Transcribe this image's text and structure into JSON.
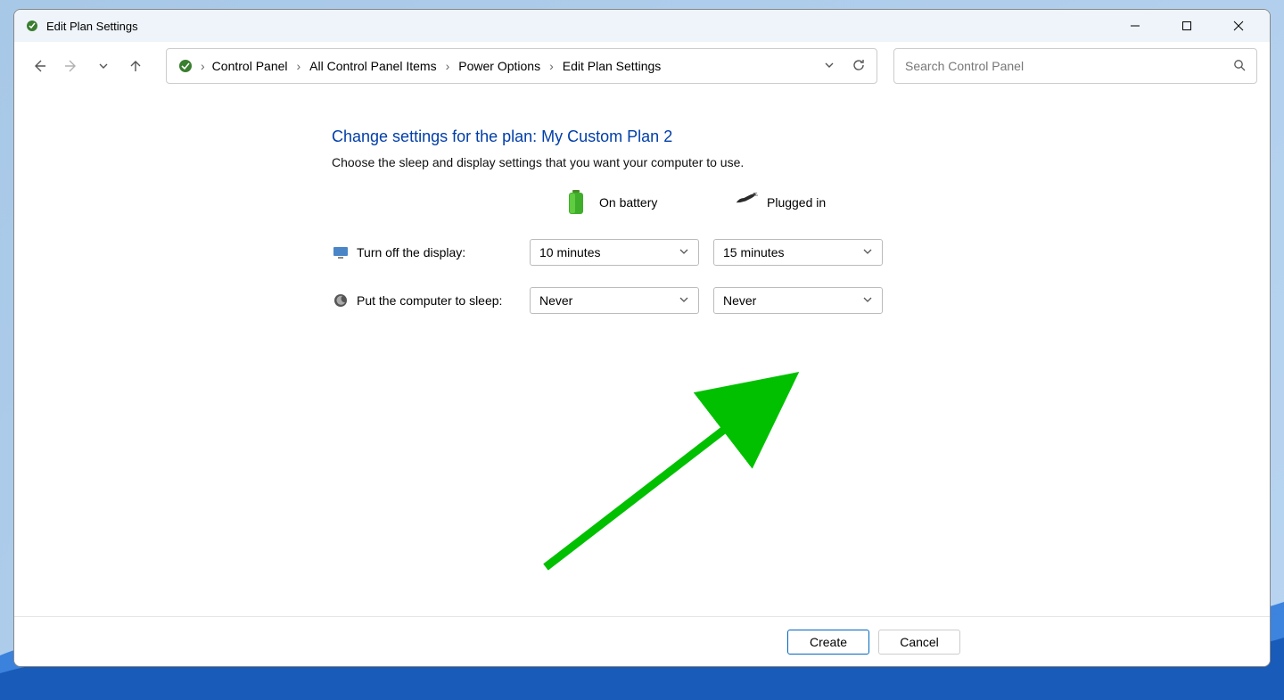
{
  "window": {
    "title": "Edit Plan Settings"
  },
  "breadcrumb": {
    "items": [
      "Control Panel",
      "All Control Panel Items",
      "Power Options",
      "Edit Plan Settings"
    ]
  },
  "search": {
    "placeholder": "Search Control Panel"
  },
  "page": {
    "heading": "Change settings for the plan: My Custom Plan 2",
    "sub": "Choose the sleep and display settings that you want your computer to use.",
    "columns": {
      "battery": "On battery",
      "plugged": "Plugged in"
    },
    "rows": {
      "display": {
        "label": "Turn off the display:",
        "battery": "10 minutes",
        "plugged": "15 minutes"
      },
      "sleep": {
        "label": "Put the computer to sleep:",
        "battery": "Never",
        "plugged": "Never"
      }
    }
  },
  "footer": {
    "create": "Create",
    "cancel": "Cancel"
  },
  "annotation": {
    "arrow_color": "#00c000",
    "target": "create-button"
  }
}
